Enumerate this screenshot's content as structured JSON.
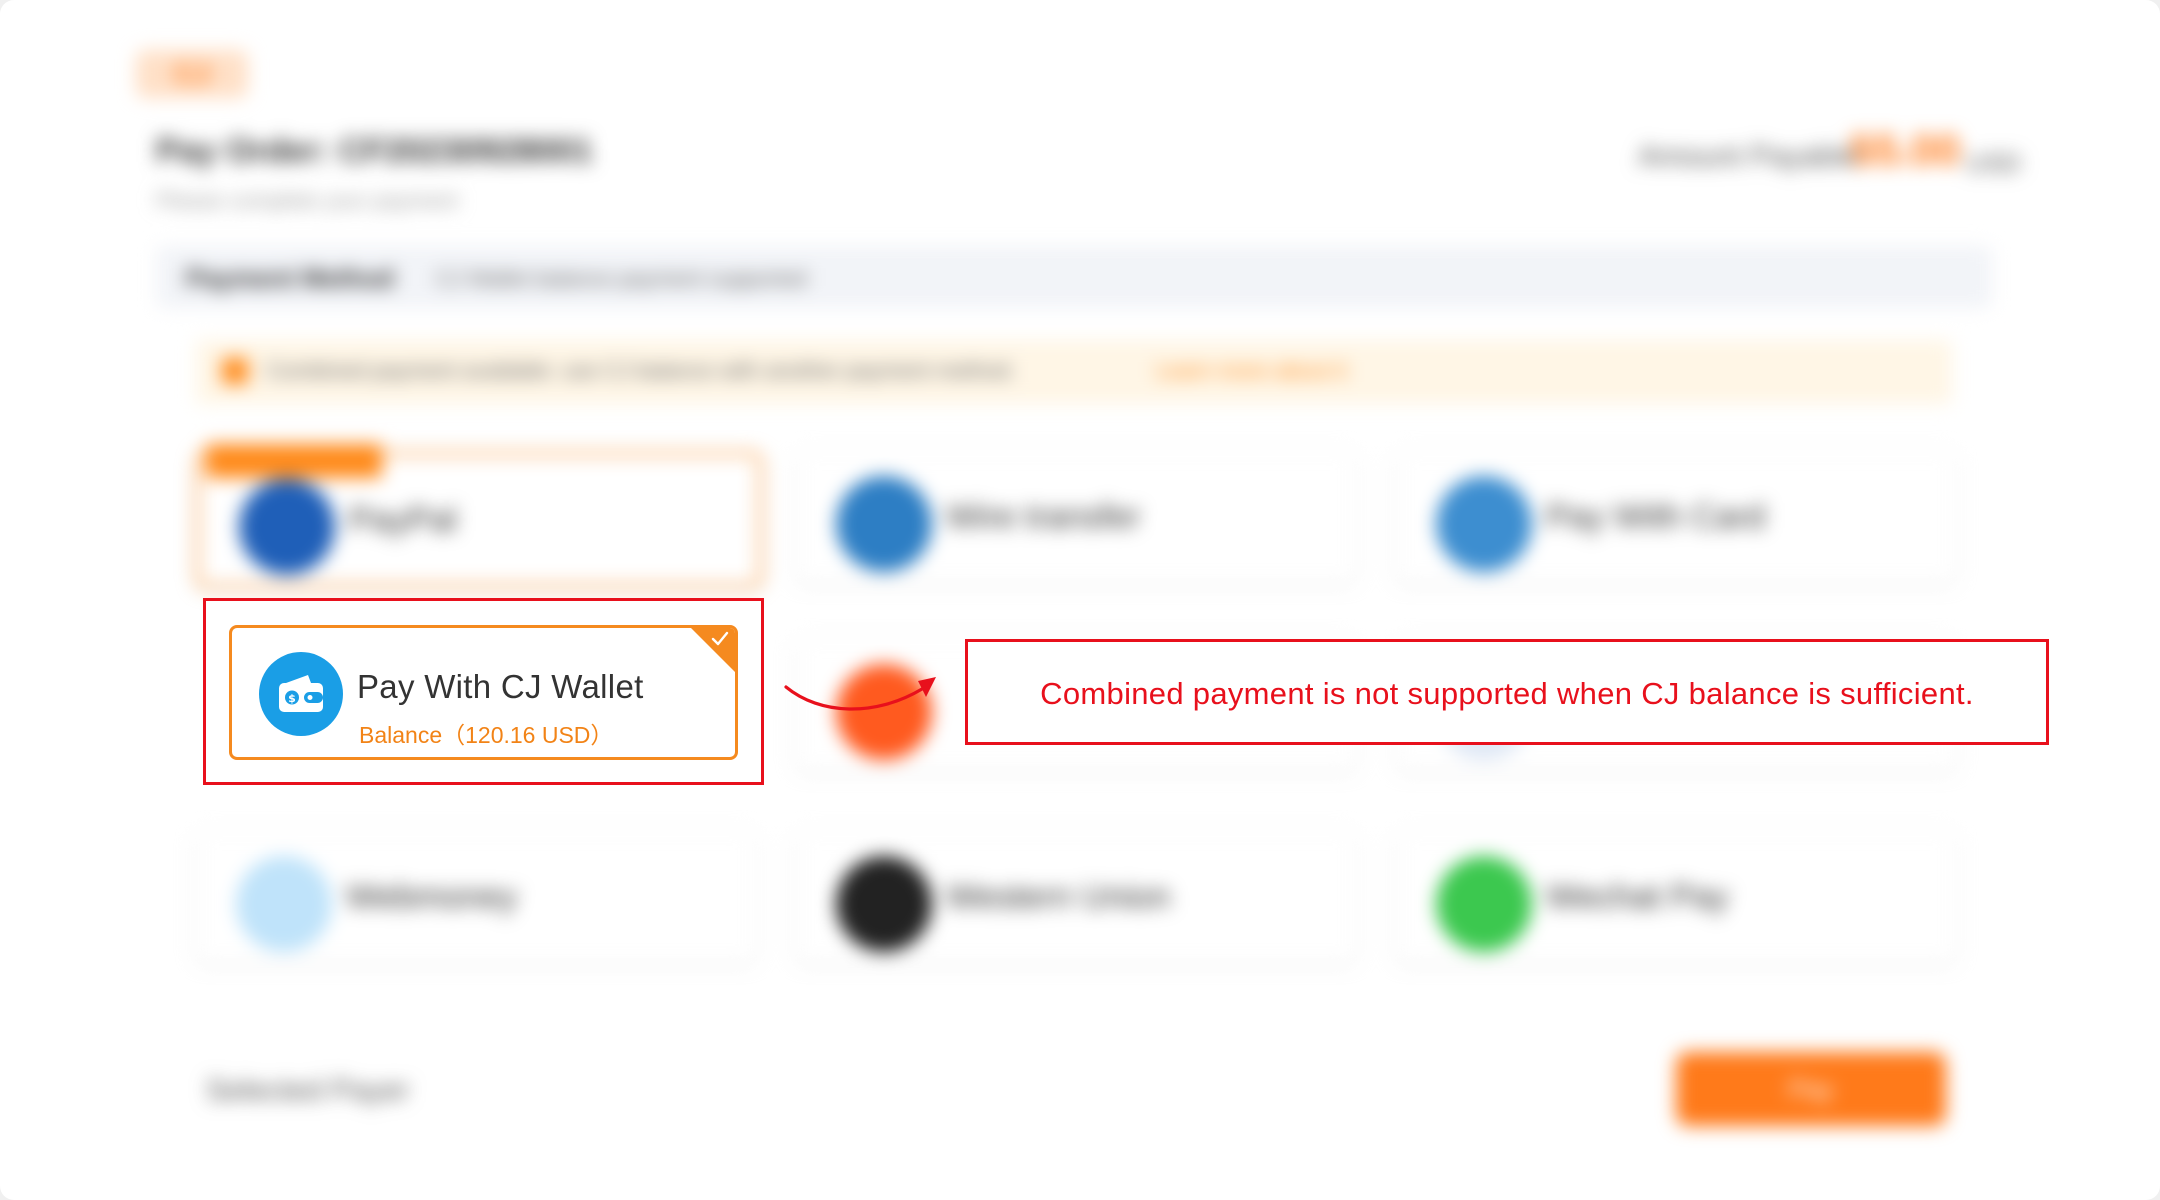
{
  "header": {
    "logo_text": "CJ",
    "order_number": "Pay Order: CF20230928001",
    "sub_text": "Please complete your payment",
    "total_label": "Amount Payable:",
    "total_amount": "55.00",
    "total_currency": "USD"
  },
  "address": {
    "label": "Payment Method",
    "text": "CJ Wallet balance payment supported"
  },
  "notice": {
    "text": "Combined payment available: use CJ balance with another payment method.",
    "link": "Learn more about it"
  },
  "payment_methods": [
    {
      "label": "PayPal",
      "icon": "paypal-icon",
      "color": "#1f5fb8"
    },
    {
      "label": "Wire transfer",
      "icon": "bank-icon",
      "color": "#2d7ec4"
    },
    {
      "label": "Pay With Card",
      "icon": "card-icon",
      "color": "#3d8ed0"
    },
    {
      "label": "",
      "icon": "orange-circle-icon",
      "color": "#ff5a1f"
    },
    {
      "label": "Webmoney",
      "icon": "webmoney-icon",
      "color": "#bfe3fa"
    },
    {
      "label": "Western Union",
      "icon": "western-union-icon",
      "color": "#222222"
    },
    {
      "label": "Wechat Pay",
      "icon": "wechat-icon",
      "color": "#3cc84f"
    }
  ],
  "wallet": {
    "title": "Pay With CJ Wallet",
    "balance": "Balance（120.16 USD）",
    "icon": "wallet-icon",
    "accent": "#f58a1f",
    "icon_color": "#1a9ee6"
  },
  "annotation": {
    "message": "Combined payment is not supported when CJ balance is sufficient.",
    "color": "#e8101c"
  },
  "footer": {
    "left_text": "Selected Payer",
    "button_label": "Pay"
  }
}
